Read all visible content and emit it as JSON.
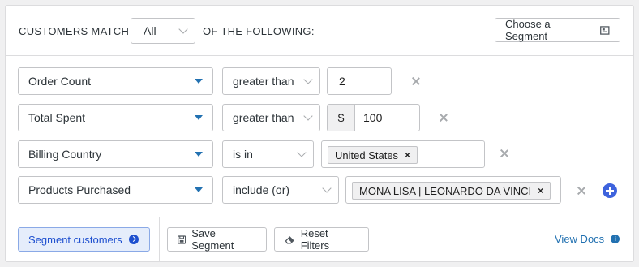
{
  "header": {
    "match_label": "CUSTOMERS MATCH",
    "match_select": "All",
    "following_label": "OF THE FOLLOWING:",
    "segment_button": "Choose a Segment"
  },
  "rows": [
    {
      "field": "Order Count",
      "operator": "greater than",
      "value": "2"
    },
    {
      "field": "Total Spent",
      "operator": "greater than",
      "prefix": "$",
      "value": "100"
    },
    {
      "field": "Billing Country",
      "operator": "is in",
      "tag": "United States"
    },
    {
      "field": "Products Purchased",
      "operator": "include (or)",
      "tag": "MONA LISA | LEONARDO DA VINCI"
    }
  ],
  "tag_remove": "×",
  "footer": {
    "segment_customers": "Segment customers",
    "save_segment": "Save Segment",
    "reset_filters": "Reset Filters",
    "view_docs": "View Docs",
    "info_glyph": "i"
  },
  "colors": {
    "accent": "#2271b1",
    "primary_button_text": "#1d4fcf",
    "primary_button_bg": "#e5edfb",
    "add_button": "#3e63dd"
  }
}
